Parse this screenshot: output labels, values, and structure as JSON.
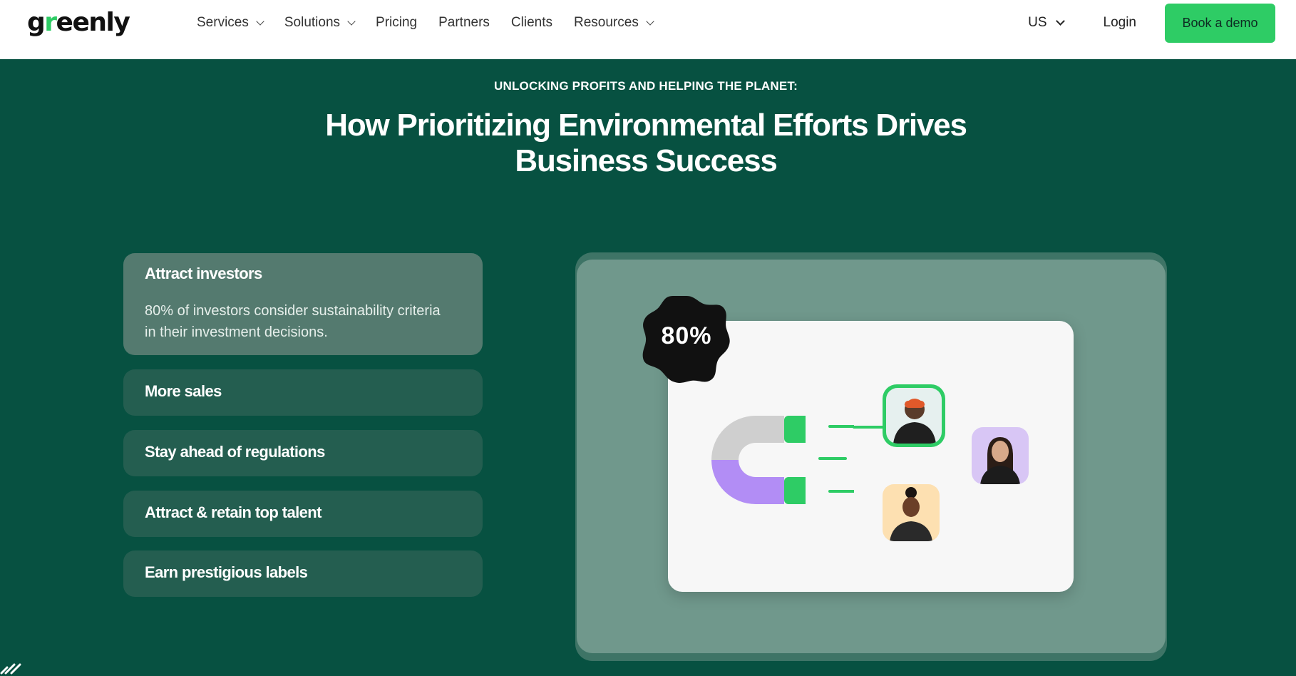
{
  "header": {
    "logo": "greenly",
    "nav": [
      {
        "label": "Services",
        "dropdown": true
      },
      {
        "label": "Solutions",
        "dropdown": true
      },
      {
        "label": "Pricing",
        "dropdown": false
      },
      {
        "label": "Partners",
        "dropdown": false
      },
      {
        "label": "Clients",
        "dropdown": false
      },
      {
        "label": "Resources",
        "dropdown": true
      }
    ],
    "country": "US",
    "login": "Login",
    "cta": "Book a demo"
  },
  "hero": {
    "kicker": "UNLOCKING PROFITS AND HELPING THE PLANET:",
    "headline_line1": "How Prioritizing Environmental Efforts Drives",
    "headline_line2": "Business Success"
  },
  "benefits": [
    {
      "title": "Attract investors",
      "description": "80% of investors consider sustainability criteria in their investment decisions.",
      "open": true
    },
    {
      "title": "More sales",
      "open": false
    },
    {
      "title": "Stay ahead of regulations",
      "open": false
    },
    {
      "title": "Attract & retain top talent",
      "open": false
    },
    {
      "title": "Earn prestigious labels",
      "open": false
    }
  ],
  "illustration": {
    "badge": "80%",
    "icons": [
      "magnet-icon",
      "person-avatar",
      "person-avatar",
      "person-avatar"
    ]
  },
  "colors": {
    "background": "#075141",
    "accent": "#2ecc65",
    "accordion": "#245e50",
    "accordion_open": "#547a6f"
  }
}
